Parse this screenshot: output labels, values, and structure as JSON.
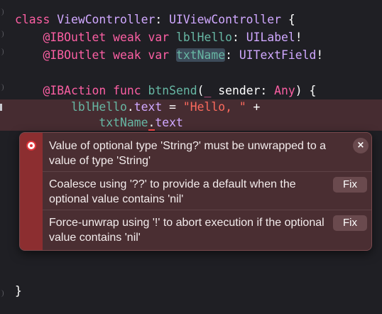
{
  "editor": {
    "lines": [
      {
        "tokens": [
          {
            "t": "class ",
            "c": "kw"
          },
          {
            "t": "ViewController",
            "c": "type"
          },
          {
            "t": ": ",
            "c": "plain"
          },
          {
            "t": "UIViewController",
            "c": "type"
          },
          {
            "t": " {",
            "c": "plain"
          }
        ]
      },
      {
        "tokens": [
          {
            "t": "    ",
            "c": "plain"
          },
          {
            "t": "@IBOutlet",
            "c": "kw"
          },
          {
            "t": " ",
            "c": "plain"
          },
          {
            "t": "weak",
            "c": "kw"
          },
          {
            "t": " ",
            "c": "plain"
          },
          {
            "t": "var",
            "c": "kw"
          },
          {
            "t": " ",
            "c": "plain"
          },
          {
            "t": "lblHello",
            "c": "prop"
          },
          {
            "t": ": ",
            "c": "plain"
          },
          {
            "t": "UILabel",
            "c": "type"
          },
          {
            "t": "!",
            "c": "plain"
          }
        ]
      },
      {
        "tokens": [
          {
            "t": "    ",
            "c": "plain"
          },
          {
            "t": "@IBOutlet",
            "c": "kw"
          },
          {
            "t": " ",
            "c": "plain"
          },
          {
            "t": "weak",
            "c": "kw"
          },
          {
            "t": " ",
            "c": "plain"
          },
          {
            "t": "var",
            "c": "kw"
          },
          {
            "t": " ",
            "c": "plain"
          },
          {
            "t": "txtName",
            "c": "prop hl"
          },
          {
            "t": ": ",
            "c": "plain"
          },
          {
            "t": "UITextField",
            "c": "type"
          },
          {
            "t": "!",
            "c": "plain"
          }
        ]
      },
      {
        "tokens": []
      },
      {
        "tokens": [
          {
            "t": "    ",
            "c": "plain"
          },
          {
            "t": "@IBAction",
            "c": "kw"
          },
          {
            "t": " ",
            "c": "plain"
          },
          {
            "t": "func",
            "c": "kw"
          },
          {
            "t": " ",
            "c": "plain"
          },
          {
            "t": "btnSend",
            "c": "prop"
          },
          {
            "t": "(",
            "c": "plain"
          },
          {
            "t": "_",
            "c": "kw"
          },
          {
            "t": " sender: ",
            "c": "plain"
          },
          {
            "t": "Any",
            "c": "kw"
          },
          {
            "t": ") {",
            "c": "plain"
          }
        ]
      },
      {
        "tokens": [
          {
            "t": "        ",
            "c": "plain"
          },
          {
            "t": "lblHello",
            "c": "prop"
          },
          {
            "t": ".",
            "c": "plain"
          },
          {
            "t": "text",
            "c": "type"
          },
          {
            "t": " = ",
            "c": "plain"
          },
          {
            "t": "\"Hello, \"",
            "c": "str"
          },
          {
            "t": " +",
            "c": "plain"
          }
        ]
      },
      {
        "tokens": [
          {
            "t": "            ",
            "c": "plain"
          },
          {
            "t": "txtName",
            "c": "prop"
          },
          {
            "t": ".",
            "c": "plain err-underline"
          },
          {
            "t": "text",
            "c": "type"
          }
        ]
      }
    ],
    "closing_brace": "}"
  },
  "error_popover": {
    "title": "Value of optional type 'String?' must be unwrapped to a value of type 'String'",
    "close_label": "×",
    "fixes": [
      {
        "message": "Coalesce using '??' to provide a default when the optional value contains 'nil'",
        "button_label": "Fix"
      },
      {
        "message": "Force-unwrap using '!' to abort execution if the optional value contains 'nil'",
        "button_label": "Fix"
      }
    ],
    "icon": "error-circle-icon"
  },
  "colors": {
    "background": "#1f1f24",
    "keyword": "#fc5fa3",
    "type": "#d0a8ff",
    "property": "#67b7a4",
    "string": "#fc6a5d",
    "error_line": "#462c31",
    "error_accent": "#8c2e30"
  }
}
